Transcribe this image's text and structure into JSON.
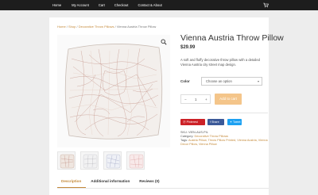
{
  "nav": {
    "items": [
      "Home",
      "My Account",
      "Cart",
      "Checkout",
      "Contact & About"
    ],
    "cart_icon": "cart-icon"
  },
  "breadcrumb": {
    "home": "Home",
    "sep1": " / ",
    "shop": "Shop",
    "sep2": " / ",
    "category": "Decorative Throw Pillows",
    "sep3": " / ",
    "current": "Vienna Austria Throw Pillow"
  },
  "product": {
    "title": "Vienna Austria Throw Pillow",
    "price": "$29.99",
    "description": "A soft and fluffy decorative throw pillow with a detailed Vienna Austria city street map design.",
    "color_label": "Color",
    "color_placeholder": "Choose an option",
    "qty_minus": "−",
    "qty_value": "1",
    "qty_plus": "+",
    "add_to_cart": "Add to cart"
  },
  "share": {
    "pinterest": "Pinterest",
    "facebook": "Share",
    "twitter": "Tweet"
  },
  "meta": {
    "sku_label": "SKU:",
    "sku_value": "VIEN-AUS-PIL",
    "category_label": "Category:",
    "category_value": "Decorative Throw Pillows",
    "tags_label": "Tags:",
    "tags_value": "Austria Pillow, Throw Pillow Printed, Vienna Austria, Vienna Decor Pillow, Vienna Pillow"
  },
  "tabs": [
    "Description",
    "Additional information",
    "Reviews (0)"
  ],
  "colors": {
    "accent": "#c48a3a",
    "topbar": "#1d1d1d",
    "add_button": "#f4c58a",
    "pinterest": "#cc2127",
    "facebook": "#3b5998",
    "twitter": "#1da1f2"
  }
}
